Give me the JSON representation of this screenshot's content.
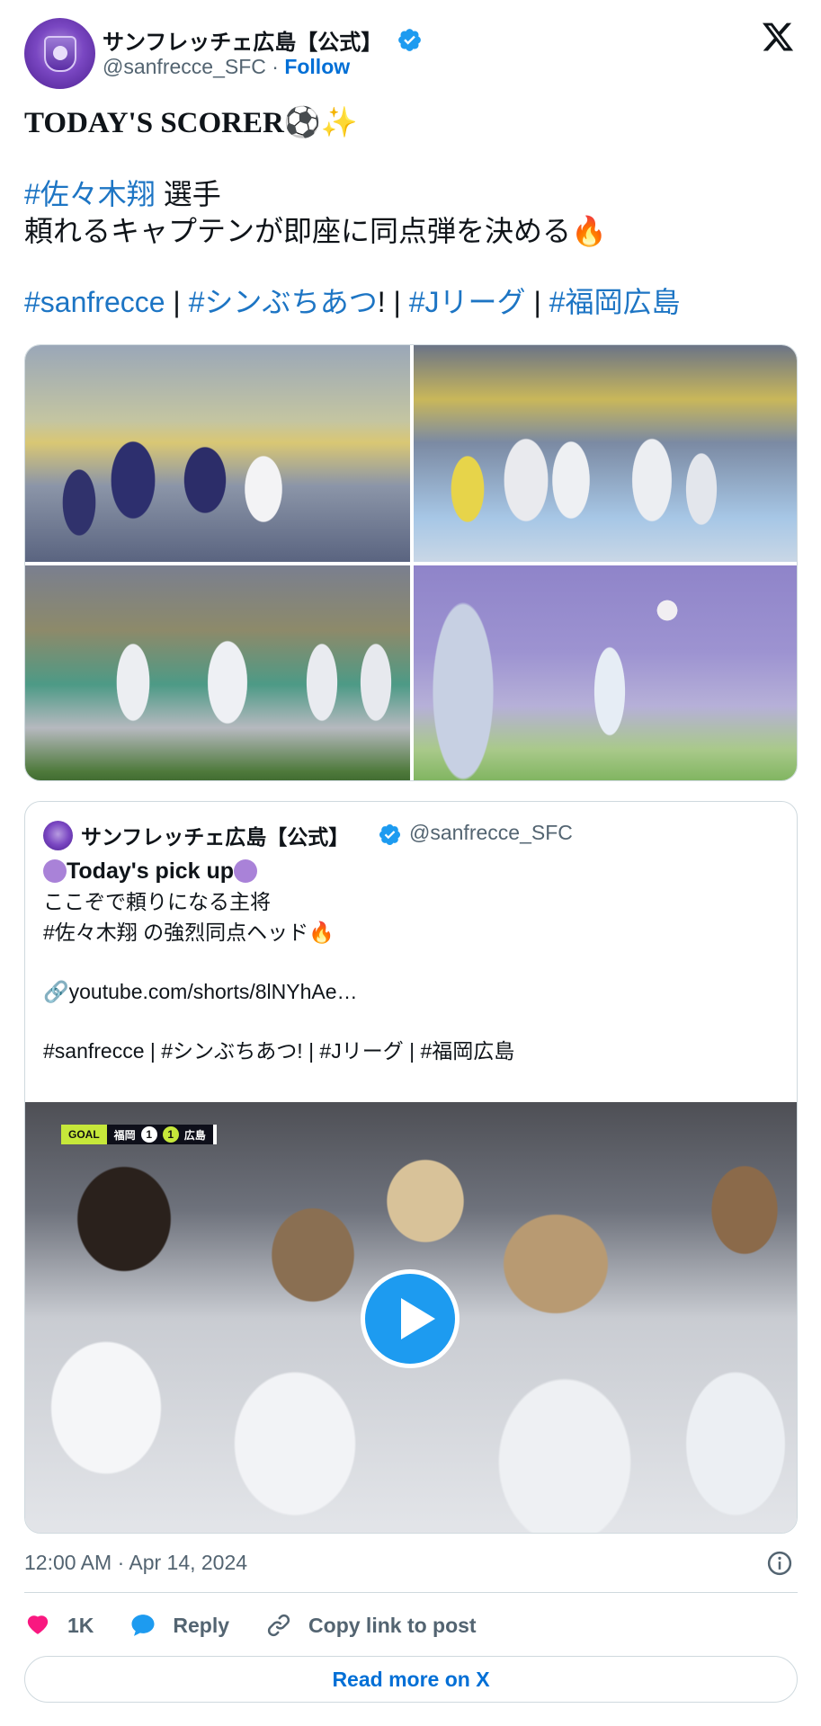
{
  "author": {
    "name": "サンフレッチェ広島【公式】",
    "handle": "@sanfrecce_SFC",
    "separator": "·",
    "follow_label": "Follow"
  },
  "tweet": {
    "headline": "TODAY'S SCORER⚽✨",
    "player_tag": "#佐々木翔",
    "player_suffix": " 選手",
    "body_line": "頼れるキャプテンが即座に同点弾を決める🔥",
    "tags": [
      "#sanfrecce",
      "#シンぶちあつ",
      "#Jリーグ",
      "#福岡広島"
    ],
    "tag_separators": [
      " | ",
      "! | ",
      " | "
    ]
  },
  "quoted": {
    "name": "サンフレッチェ広島【公式】",
    "handle": "@sanfrecce_SFC",
    "pick_up": "Today's pick up",
    "line1": "ここぞで頼りになる主将",
    "line2": "#佐々木翔 の強烈同点ヘッド🔥",
    "link": "🔗youtube.com/shorts/8lNYhAe…",
    "tags_line": "#sanfrecce | #シンぶちあつ! | #Jリーグ | #福岡広島",
    "video": {
      "goal_label": "GOAL",
      "home_team": "福岡",
      "home_score": "1",
      "away_score": "1",
      "away_team": "広島"
    }
  },
  "footer": {
    "timestamp": "12:00 AM · Apr 14, 2024",
    "like_count": "1K",
    "reply_label": "Reply",
    "copy_label": "Copy link to post",
    "read_more": "Read more on X"
  },
  "colors": {
    "link": "#1d75c4",
    "follow": "#006fd6",
    "verified": "#1d9bf0",
    "like": "#f91880"
  },
  "icons": [
    "verified-badge-icon",
    "x-logo-icon",
    "play-icon",
    "info-icon",
    "heart-icon",
    "reply-bubble-icon",
    "link-icon"
  ]
}
